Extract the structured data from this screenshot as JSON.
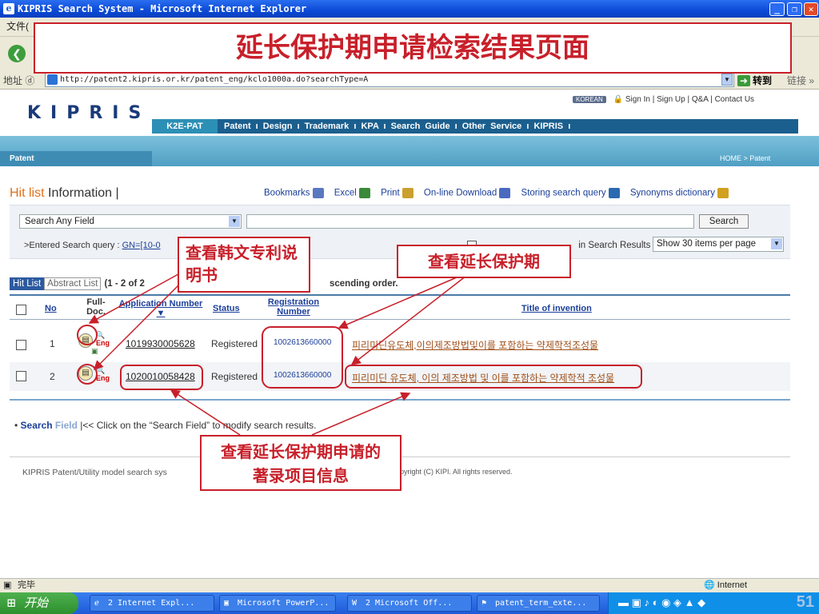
{
  "window": {
    "title": "KIPRIS Search System - Microsoft Internet Explorer",
    "menu_first": "文件(",
    "address_label": "地址 ⓓ",
    "address_url": "http://patent2.kipris.or.kr/patent_eng/kclo1000a.do?searchType=A",
    "go_label": "转到",
    "links_label": "链接 »"
  },
  "slide": {
    "headline": "延长保护期申请检索结果页面",
    "note_korean_spec": "查看韩文专利说明书",
    "note_extension": "查看延长保护期",
    "note_biblio": "查看延长保护期申请的著录项目信息"
  },
  "site": {
    "logo": "KIPRIS",
    "top_links": {
      "korean": "KOREAN",
      "sign_in": "Sign In",
      "sign_up": "Sign Up",
      "qa": "Q&A",
      "contact": "Contact Us"
    },
    "gnb": {
      "k2e": "K2E-PAT",
      "items": [
        "Patent",
        "Design",
        "Trademark",
        "KPA",
        "Search Guide",
        "Other Service",
        "KIPRIS"
      ]
    },
    "section_tab": "Patent",
    "breadcrumb": "HOME > Patent"
  },
  "hitlist": {
    "title_hit": "Hit list",
    "title_info": " Information",
    "toolbar": [
      "Bookmarks",
      "Excel",
      "Print",
      "On-line Download",
      "Storing search query",
      "Synonyms dictionary"
    ]
  },
  "search": {
    "field_select": "Search Any Field",
    "query_value": "",
    "search_button": "Search",
    "entered_label": ">Entered Search query :",
    "entered_query": "GN=[10-0",
    "in_results_label": "in Search Results",
    "per_page": "Show 30 items per page"
  },
  "list": {
    "tab_hitlist": "Hit List",
    "tab_abstract": "Abstract List",
    "count_text": "(1 - 2  of  2",
    "sort_text": "scending order.",
    "headers": {
      "no": "No",
      "fulldoc": "Full-Doc.",
      "application": "Application Number",
      "status": "Status",
      "registration": "Registration Number",
      "title": "Title of invention"
    },
    "rows": [
      {
        "no": "1",
        "app": "1019930005628",
        "status": "Registered",
        "reg": "1002613660000",
        "title": "피리미딘유도체,이의제조방법및이를 포함하는 약제학적조성물"
      },
      {
        "no": "2",
        "app": "1020010058428",
        "status": "Registered",
        "reg": "1002613660000",
        "title": "피리미딘 유도체, 이의 제조방법 및 이를 포함하는 약제학적 조성물"
      }
    ],
    "eng_label": "Eng"
  },
  "search_field": {
    "s": "Search",
    "f": " Field",
    "hint": "|<< Click on the “Search Field” to modify search results."
  },
  "footer": {
    "left": "KIPRIS Patent/Utility model search sys",
    "copyright": "pyright (C) KIPI. All rights reserved."
  },
  "statusbar": {
    "done": "完毕",
    "zone": "Internet"
  },
  "taskbar": {
    "start": "开始",
    "tasks": [
      "2 Internet Expl...",
      "Microsoft PowerP...",
      "2 Microsoft Off...",
      "patent_term_exte..."
    ],
    "slide_number": "51"
  },
  "colors": {
    "annotation": "#c8202a",
    "gnb": "#1b5f8e",
    "link": "#1b3f9a"
  }
}
